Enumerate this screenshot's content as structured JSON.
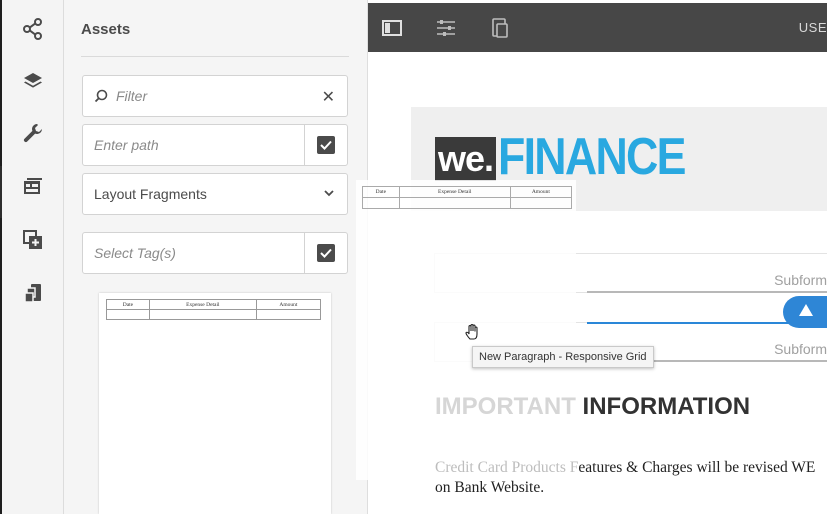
{
  "assets_panel": {
    "title": "Assets",
    "filter_placeholder": "Filter",
    "path_placeholder": "Enter path",
    "category": "Layout Fragments",
    "tags_placeholder": "Select Tag(s)"
  },
  "fragment_table": {
    "headers": [
      "Date",
      "Expense Detail",
      "Amount"
    ]
  },
  "toolbar": {
    "right_text": "USE"
  },
  "canvas": {
    "logo_we": "we.",
    "logo_finance": "FINANCE",
    "subform_label": "Subform",
    "tooltip": "New Paragraph - Responsive Grid",
    "heading_light": "IMPORTANT",
    "heading_dark": "INFORMATION",
    "para_dim": "Credit Card Products F",
    "para_rest": "eatures & Charges will be revised WE",
    "para_line2": "on Bank Website."
  },
  "colors": {
    "accent_blue": "#2e86d6",
    "logo_blue": "#29a8e0",
    "toolbar_bg": "#474747"
  },
  "icons": [
    "share-icon",
    "layers-icon",
    "wrench-icon",
    "assets-icon",
    "add-component-icon",
    "content-tree-icon",
    "search-icon",
    "close-icon",
    "chevron-down-icon",
    "checkbox-icon",
    "side-panel-icon",
    "properties-icon",
    "emulator-icon",
    "hand-cursor-icon",
    "arrow-up-icon"
  ]
}
